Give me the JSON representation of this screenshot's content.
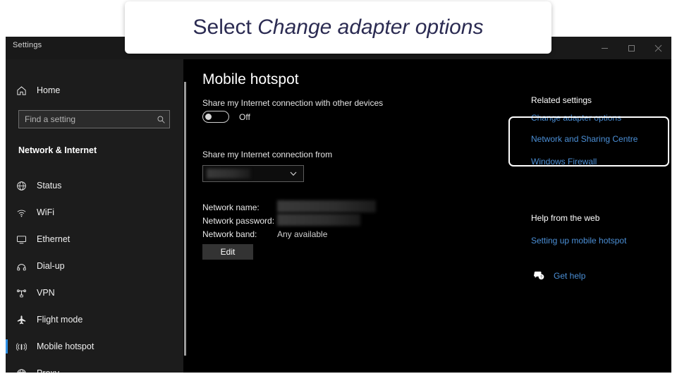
{
  "banner": {
    "prefix": "Select ",
    "emphasis": "Change adapter options"
  },
  "window": {
    "title": "Settings",
    "controls": {
      "minimize": "minimize-icon",
      "maximize": "maximize-icon",
      "close": "close-icon"
    }
  },
  "sidebar": {
    "home_label": "Home",
    "home_icon": "home-icon",
    "search": {
      "placeholder": "Find a setting",
      "value": "",
      "icon": "search-icon"
    },
    "section_heading": "Network & Internet",
    "items": [
      {
        "label": "Status",
        "icon": "globe-status-icon",
        "selected": false
      },
      {
        "label": "WiFi",
        "icon": "wifi-icon",
        "selected": false
      },
      {
        "label": "Ethernet",
        "icon": "ethernet-icon",
        "selected": false
      },
      {
        "label": "Dial-up",
        "icon": "dialup-icon",
        "selected": false
      },
      {
        "label": "VPN",
        "icon": "vpn-icon",
        "selected": false
      },
      {
        "label": "Flight mode",
        "icon": "airplane-icon",
        "selected": false
      },
      {
        "label": "Mobile hotspot",
        "icon": "hotspot-icon",
        "selected": true
      },
      {
        "label": "Proxy",
        "icon": "globe-icon",
        "selected": false
      }
    ]
  },
  "main": {
    "page_title": "Mobile hotspot",
    "share_label": "Share my Internet connection with other devices",
    "toggle_state": "Off",
    "share_from_label": "Share my Internet connection from",
    "dropdown_value": "",
    "dropdown_icon": "chevron-down-icon",
    "details": [
      {
        "label": "Network name:",
        "value": ""
      },
      {
        "label": "Network password:",
        "value": ""
      },
      {
        "label": "Network band:",
        "value": "Any available"
      }
    ],
    "edit_button": "Edit"
  },
  "right_rail": {
    "related_heading": "Related settings",
    "links": [
      "Change adapter options",
      "Network and Sharing Centre",
      "Windows Firewall"
    ],
    "help_heading": "Help from the web",
    "help_link": "Setting up mobile hotspot",
    "get_help_label": "Get help",
    "get_help_icon": "help-bubble-icon"
  },
  "colors": {
    "accent_link": "#4b8fd6",
    "selection_bar": "#2f8fe3",
    "banner_text": "#2b2b52",
    "window_bg": "#000000",
    "sidebar_bg": "#1c1c1c"
  }
}
